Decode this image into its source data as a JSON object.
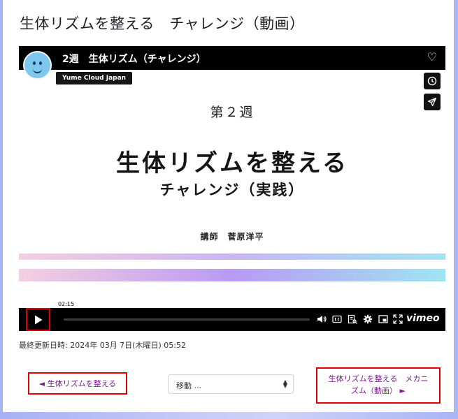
{
  "page": {
    "title": "生体リズムを整える　チャレンジ（動画）",
    "last_modified": "最終更新日時: 2024年 03月 7日(木曜日) 05:52"
  },
  "video": {
    "title": "2週　生体リズム（チャレンジ）",
    "channel": "Yume Cloud Japan",
    "slide": {
      "week": "第２週",
      "main": "生体リズムを整える",
      "sub": "チャレンジ（実践）",
      "lecturer": "講師　菅原洋平"
    },
    "time_tooltip": "02:15",
    "brand": "vimeo",
    "progress": 0.0,
    "icons": [
      "heart-icon",
      "clock-icon",
      "send-icon",
      "play-icon",
      "volume-icon",
      "cc-icon",
      "transcript-icon",
      "settings-icon",
      "pip-icon",
      "fullscreen-icon"
    ]
  },
  "nav": {
    "prev_label": "◄ 生体リズムを整える",
    "jump_placeholder": "移動 ...",
    "next_line1": "生体リズムを整える　メカニ",
    "next_line2": "ズム（動画）  ►"
  },
  "colors": {
    "link": "#7b1c8c",
    "highlight_border": "#e30000",
    "player_bar": "#000000",
    "page_background": "#b8c0f6"
  }
}
